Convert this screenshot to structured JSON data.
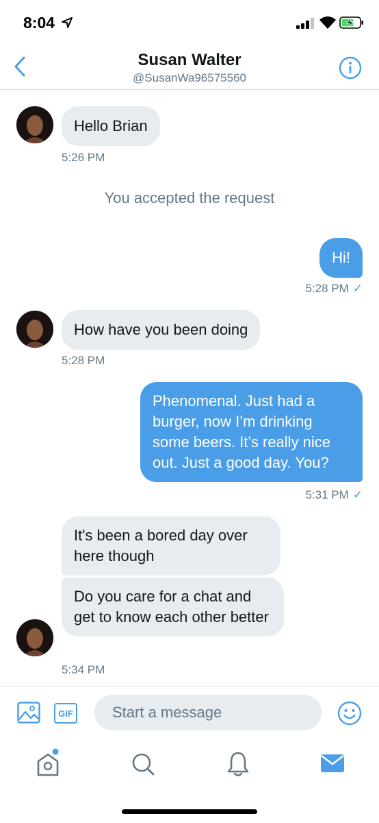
{
  "status_bar": {
    "time": "8:04"
  },
  "header": {
    "name": "Susan Walter",
    "handle": "@SusanWa96575560"
  },
  "messages": [
    {
      "text": "Hello Brian",
      "time": "5:26 PM"
    },
    {
      "system": "You accepted the request"
    },
    {
      "text": "Hi!",
      "time": "5:28 PM",
      "check": "✓"
    },
    {
      "text": "How have you been doing",
      "time": "5:28 PM"
    },
    {
      "text": "Phenomenal. Just had a burger, now I’m drinking some beers. It’s really nice out. Just a good day. You?",
      "time": "5:31 PM",
      "check": "✓"
    },
    {
      "text": "It's been a bored day over here though"
    },
    {
      "text": "Do you care for a chat and get to know each other better",
      "time": "5:34 PM"
    }
  ],
  "composer": {
    "placeholder": "Start a message",
    "gif_label": "GIF"
  },
  "tabs": [
    "home-icon",
    "search-icon",
    "notifications-icon",
    "messages-icon"
  ],
  "colors": {
    "accent": "#4a9ee8",
    "bubble_in": "#e6ecf0",
    "muted": "#657786"
  }
}
